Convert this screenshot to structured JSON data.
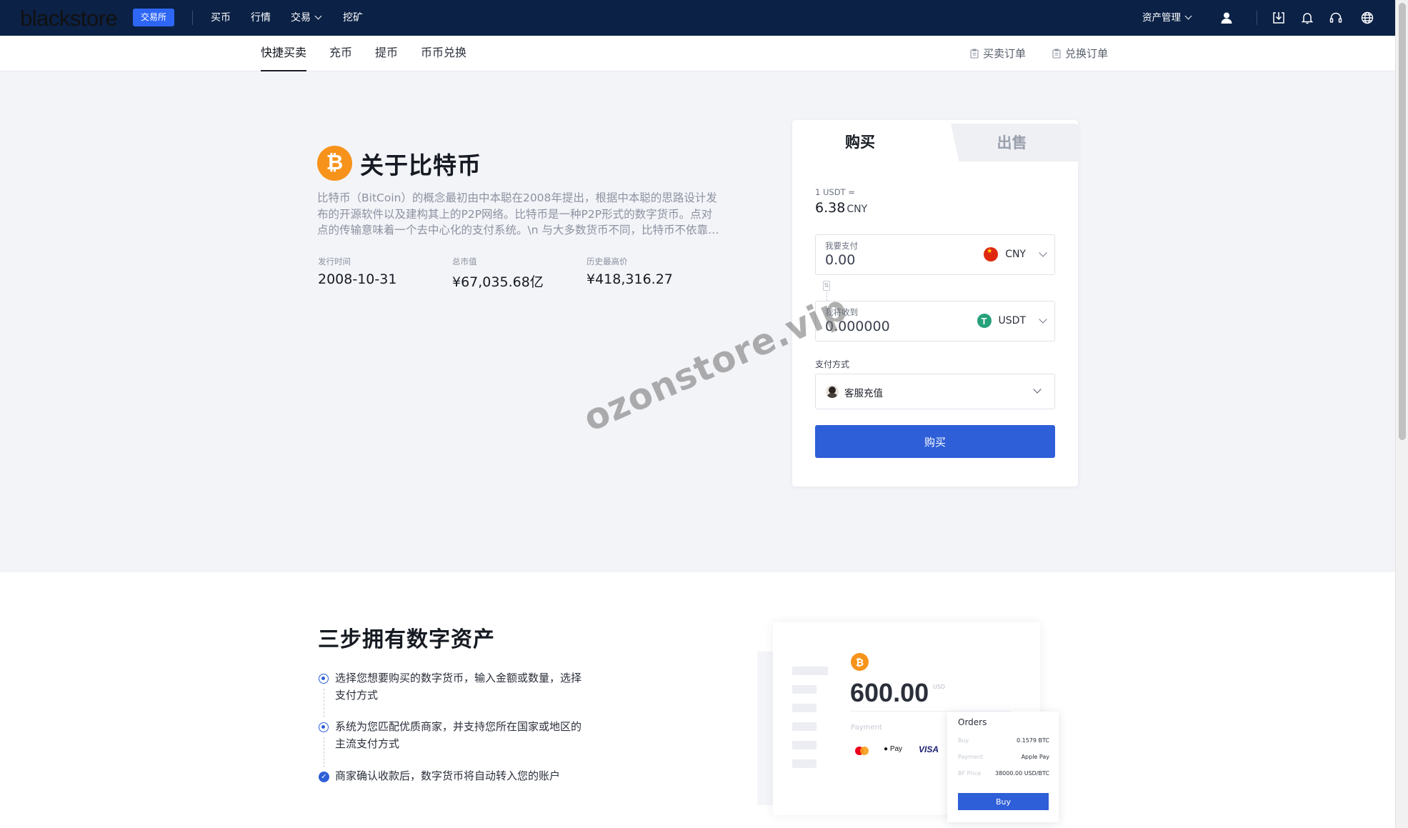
{
  "nav": {
    "logo": "blackstore",
    "badge": "交易所",
    "items": [
      {
        "label": "买币"
      },
      {
        "label": "行情"
      },
      {
        "label": "交易"
      },
      {
        "label": "挖矿"
      }
    ],
    "asset_management": "资产管理",
    "icons": [
      "user-icon",
      "download-icon",
      "bell-icon",
      "headset-icon",
      "globe-icon"
    ]
  },
  "subnav": {
    "tabs": [
      {
        "label": "快捷买卖",
        "active": true
      },
      {
        "label": "充币"
      },
      {
        "label": "提币"
      },
      {
        "label": "币币兑换"
      }
    ],
    "links": [
      "买卖订单",
      "兑换订单"
    ]
  },
  "hero": {
    "coin_symbol": "₿",
    "title": "关于比特币",
    "description": "比特币（BitCoin）的概念最初由中本聪在2008年提出，根据中本聪的思路设计发布的开源软件以及建构其上的P2P网络。比特币是一种P2P形式的数字货币。点对点的传输意味着一个去中心化的支付系统。\\n 与大多数货币不同，比特币不依靠特定货币机构发行",
    "stats": [
      {
        "label": "发行时间",
        "value": "2008-10-31"
      },
      {
        "label": "总市值",
        "value": "¥67,035.68亿"
      },
      {
        "label": "历史最高价",
        "value": "¥418,316.27"
      }
    ]
  },
  "trade": {
    "tab_buy": "购买",
    "tab_sell": "出售",
    "rate_label": "1 USDT ≈",
    "rate_value": "6.38",
    "rate_unit": "CNY",
    "pay_field": {
      "label": "我要支付",
      "value": "0.00",
      "currency": "CNY"
    },
    "receive_field": {
      "label": "我将收到",
      "value": "0.000000",
      "currency": "USDT"
    },
    "payment_method_label": "支付方式",
    "payment_method": "客服充值",
    "buy_button": "购买",
    "accent_color": "#2e5fd8"
  },
  "watermark": "ozonstore.vip",
  "steps": {
    "title": "三步拥有数字资产",
    "items": [
      "选择您想要购买的数字货币，输入金额或数量，选择支付方式",
      "系统为您匹配优质商家，并支持您所在国家或地区的主流支付方式",
      "商家确认收款后，数字货币将自动转入您的账户"
    ]
  },
  "illustration": {
    "coin_symbol": "₿",
    "amount": "600.00",
    "amount_unit": "USD",
    "payment_label": "Payment",
    "apple_pay": "Pay",
    "visa": "VISA",
    "orders": {
      "title": "Orders",
      "rows": [
        {
          "k": "Buy",
          "v": "0.1579 BTC"
        },
        {
          "k": "Payment",
          "v": "Apple Pay"
        },
        {
          "k": "BF Price",
          "v": "38000.00 USD/BTC"
        }
      ],
      "button": "Buy"
    }
  }
}
